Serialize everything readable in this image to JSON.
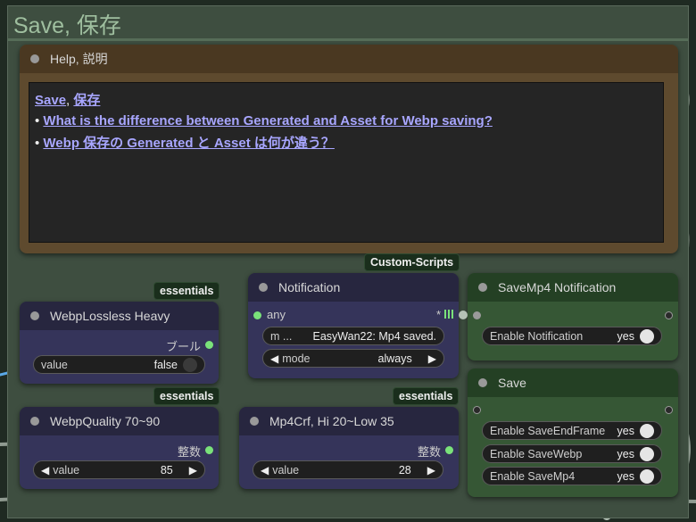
{
  "group": {
    "title": "Save, 保存"
  },
  "help": {
    "header": "Help, 説明",
    "links": {
      "save": "Save",
      "save_jp": "保存",
      "q1": "What is the difference between Generated and Asset for Webp saving?",
      "q2": "Webp 保存の Generated と Asset は何が違う？"
    },
    "separator": ", ",
    "bullet": "• "
  },
  "badges": {
    "essentials1": "essentials",
    "essentials2": "essentials",
    "essentials3": "essentials",
    "custom_scripts": "Custom-Scripts"
  },
  "webp_lossless": {
    "title": "WebpLossless Heavy",
    "output_label": "ブール",
    "widget_label": "value",
    "widget_value": "false"
  },
  "webp_quality": {
    "title": "WebpQuality 70~90",
    "output_label": "整数",
    "widget_label": "value",
    "widget_value": "85"
  },
  "notification": {
    "title": "Notification",
    "input_label": "any",
    "input_marker": "*",
    "message_label": "m ...",
    "message_value": "EasyWan22: Mp4 saved.",
    "mode_label": "mode",
    "mode_value": "always"
  },
  "mp4crf": {
    "title": "Mp4Crf, Hi 20~Low 35",
    "output_label": "整数",
    "widget_label": "value",
    "widget_value": "28"
  },
  "savemp4_notification": {
    "title": "SaveMp4 Notification",
    "widget_label": "Enable Notification",
    "widget_value": "yes"
  },
  "save": {
    "title": "Save",
    "widgets": [
      {
        "label": "Enable SaveEndFrame",
        "value": "yes"
      },
      {
        "label": "Enable SaveWebp",
        "value": "yes"
      },
      {
        "label": "Enable SaveMp4",
        "value": "yes"
      }
    ]
  },
  "colors": {
    "group_bg": "#3e4e40",
    "node_purple": "#35345a",
    "node_green": "#365735",
    "node_brown": "#5e4a2e",
    "link": "#a8a6ff",
    "wire_blue": "#5aa8e6",
    "wire_grey": "#8f9a90"
  }
}
